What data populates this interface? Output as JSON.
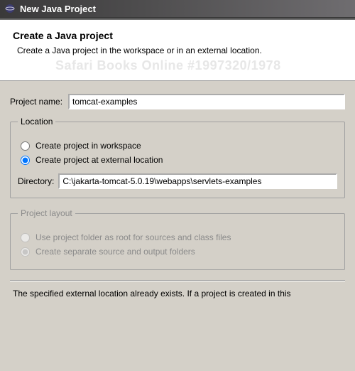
{
  "titlebar": {
    "title": "New Java Project"
  },
  "banner": {
    "heading": "Create a Java project",
    "description": "Create a Java project in the workspace or in an external location.",
    "watermark": "Safari Books Online #1997320/1978"
  },
  "project": {
    "name_label": "Project name:",
    "name_value": "tomcat-examples"
  },
  "location": {
    "legend": "Location",
    "opt_workspace": "Create project in workspace",
    "opt_external": "Create project at external location",
    "directory_label": "Directory:",
    "directory_value": "C:\\jakarta-tomcat-5.0.19\\webapps\\servlets-examples"
  },
  "layout": {
    "legend": "Project layout",
    "opt_root": "Use project folder as root for sources and class files",
    "opt_separate": "Create separate source and output folders"
  },
  "footer": {
    "note": "The specified external location already exists. If a project is created in this"
  }
}
